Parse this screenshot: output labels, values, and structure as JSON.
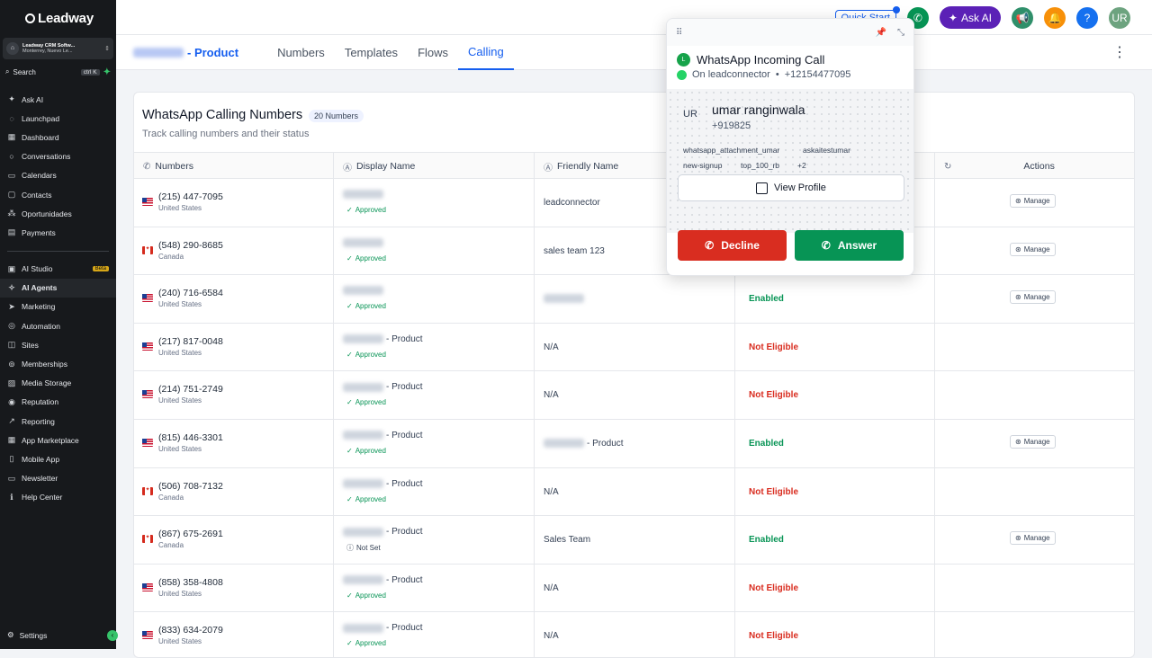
{
  "sidebar": {
    "logo": "Leadway",
    "account": {
      "name": "Leadway CRM Softw...",
      "location": "Monterrey, Nuevo Le..."
    },
    "search": {
      "label": "Search",
      "shortcut": "ctrl K"
    },
    "items_top": [
      {
        "label": "Ask AI",
        "icon": "sparkle-icon"
      },
      {
        "label": "Launchpad",
        "icon": "rocket-icon"
      },
      {
        "label": "Dashboard",
        "icon": "dashboard-icon"
      },
      {
        "label": "Conversations",
        "icon": "chat-icon"
      },
      {
        "label": "Calendars",
        "icon": "calendar-icon"
      },
      {
        "label": "Contacts",
        "icon": "contacts-icon"
      },
      {
        "label": "Oportunidades",
        "icon": "funnel-icon"
      },
      {
        "label": "Payments",
        "icon": "payments-icon"
      }
    ],
    "items_bottom": [
      {
        "label": "AI Studio",
        "icon": "ai-studio-icon",
        "badge": "Beta"
      },
      {
        "label": "AI Agents",
        "icon": "ai-agents-icon"
      },
      {
        "label": "Marketing",
        "icon": "send-icon"
      },
      {
        "label": "Automation",
        "icon": "automation-icon"
      },
      {
        "label": "Sites",
        "icon": "sites-icon"
      },
      {
        "label": "Memberships",
        "icon": "memberships-icon"
      },
      {
        "label": "Media Storage",
        "icon": "media-icon"
      },
      {
        "label": "Reputation",
        "icon": "reputation-icon"
      },
      {
        "label": "Reporting",
        "icon": "reporting-icon"
      },
      {
        "label": "App Marketplace",
        "icon": "marketplace-icon"
      },
      {
        "label": "Mobile App",
        "icon": "mobile-icon"
      },
      {
        "label": "Newsletter",
        "icon": "newsletter-icon"
      },
      {
        "label": "Help Center",
        "icon": "help-icon"
      }
    ],
    "settings": "Settings"
  },
  "topbar": {
    "quick_start": "Quick Start",
    "ask_ai": "Ask AI",
    "avatar": "UR",
    "colors": {
      "phone": "#079455",
      "askai": "#5b21b6",
      "megaphone": "#2f8f6a",
      "bell": "#f79009",
      "help": "#1570ef",
      "avatar": "#6da37f"
    }
  },
  "subnav": {
    "brand_suffix": "- Product",
    "tabs": [
      "Numbers",
      "Templates",
      "Flows",
      "Calling"
    ],
    "active_tab": "Calling"
  },
  "card": {
    "title": "WhatsApp Calling Numbers",
    "count": "20 Numbers",
    "subtitle": "Track calling numbers and their status",
    "headers": [
      "Numbers",
      "Display Name",
      "Friendly Name",
      "",
      "Actions"
    ]
  },
  "rows": [
    {
      "number": "(215) 447-7095",
      "country": "United States",
      "flag": "us",
      "display_suffix": "",
      "display_status": "Approved",
      "friendly": "leadconnector",
      "friendly_blur": false,
      "calling": "",
      "calling_class": "",
      "manage": "Manage"
    },
    {
      "number": "(548) 290-8685",
      "country": "Canada",
      "flag": "ca",
      "display_suffix": "",
      "display_status": "Approved",
      "friendly": "sales team 123",
      "friendly_blur": false,
      "calling": "",
      "calling_class": "",
      "manage": "Manage"
    },
    {
      "number": "(240) 716-6584",
      "country": "United States",
      "flag": "us",
      "display_suffix": "",
      "display_status": "Approved",
      "friendly": "",
      "friendly_blur": true,
      "calling": "Enabled",
      "calling_class": "en",
      "manage": "Manage"
    },
    {
      "number": "(217) 817-0048",
      "country": "United States",
      "flag": "us",
      "display_suffix": "- Product",
      "display_status": "Approved",
      "friendly": "N/A",
      "friendly_blur": false,
      "calling": "Not Eligible",
      "calling_class": "ne",
      "manage": ""
    },
    {
      "number": "(214) 751-2749",
      "country": "United States",
      "flag": "us",
      "display_suffix": "- Product",
      "display_status": "Approved",
      "friendly": "N/A",
      "friendly_blur": false,
      "calling": "Not Eligible",
      "calling_class": "ne",
      "manage": ""
    },
    {
      "number": "(815) 446-3301",
      "country": "United States",
      "flag": "us",
      "display_suffix": "- Product",
      "display_status": "Approved",
      "friendly": "- Product",
      "friendly_blur": true,
      "calling": "Enabled",
      "calling_class": "en",
      "manage": "Manage"
    },
    {
      "number": "(506) 708-7132",
      "country": "Canada",
      "flag": "ca",
      "display_suffix": "- Product",
      "display_status": "Approved",
      "friendly": "N/A",
      "friendly_blur": false,
      "calling": "Not Eligible",
      "calling_class": "ne",
      "manage": ""
    },
    {
      "number": "(867) 675-2691",
      "country": "Canada",
      "flag": "ca",
      "display_suffix": "- Product",
      "display_status": "Not Set",
      "friendly": "Sales Team",
      "friendly_blur": false,
      "calling": "Enabled",
      "calling_class": "en",
      "manage": "Manage"
    },
    {
      "number": "(858) 358-4808",
      "country": "United States",
      "flag": "us",
      "display_suffix": "- Product",
      "display_status": "Approved",
      "friendly": "N/A",
      "friendly_blur": false,
      "calling": "Not Eligible",
      "calling_class": "ne",
      "manage": ""
    },
    {
      "number": "(833) 634-2079",
      "country": "United States",
      "flag": "us",
      "display_suffix": "- Product",
      "display_status": "Approved",
      "friendly": "N/A",
      "friendly_blur": false,
      "calling": "Not Eligible",
      "calling_class": "ne",
      "manage": ""
    }
  ],
  "call_popup": {
    "title": "WhatsApp Incoming Call",
    "on_label": "On leadconnector",
    "on_number": "+12154477095",
    "initials": "UR",
    "caller_name": "umar ranginwala",
    "caller_number": "+919825",
    "tags": [
      "whatsapp_attachment_umar",
      "askaitestumar",
      "new-signup",
      "top_100_rb",
      "+2"
    ],
    "view_profile": "View Profile",
    "decline": "Decline",
    "answer": "Answer"
  }
}
